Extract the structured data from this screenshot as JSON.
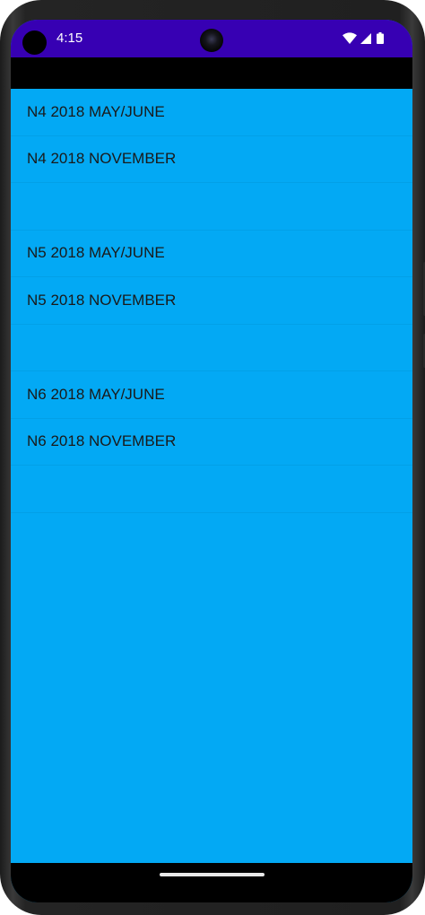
{
  "status_bar": {
    "time": "4:15",
    "icons": [
      "wifi-icon",
      "cellular-signal-icon",
      "battery-icon"
    ],
    "color": "#3700b3"
  },
  "toolbar": {
    "color": "#000000"
  },
  "list": {
    "background": "#03a9f4",
    "items": [
      {
        "label": "N4 2018 MAY/JUNE"
      },
      {
        "label": "N4 2018 NOVEMBER"
      },
      {
        "label": ""
      },
      {
        "label": "N5 2018 MAY/JUNE"
      },
      {
        "label": "N5 2018 NOVEMBER"
      },
      {
        "label": ""
      },
      {
        "label": "N6 2018 MAY/JUNE"
      },
      {
        "label": "N6 2018 NOVEMBER"
      },
      {
        "label": ""
      }
    ]
  },
  "nav_bar": {
    "gesture": "home-pill"
  }
}
